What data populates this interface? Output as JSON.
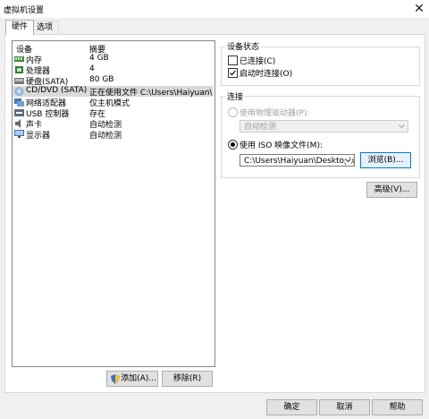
{
  "window": {
    "title": "虚拟机设置",
    "close_glyph": "✕"
  },
  "tabs": [
    {
      "label": "硬件"
    },
    {
      "label": "选项"
    }
  ],
  "device_list": {
    "headers": {
      "device": "设备",
      "summary": "摘要"
    },
    "rows": [
      {
        "name": "内存",
        "summary": "4 GB",
        "icon": "memory-icon"
      },
      {
        "name": "处理器",
        "summary": "4",
        "icon": "processor-icon"
      },
      {
        "name": "硬盘(SATA)",
        "summary": "80 GB",
        "icon": "hard-disk-icon"
      },
      {
        "name": "CD/DVD (SATA)",
        "summary": "正在使用文件 C:\\Users\\Haiyuan\\...",
        "icon": "cd-dvd-icon"
      },
      {
        "name": "网络适配器",
        "summary": "仅主机模式",
        "icon": "network-adapter-icon"
      },
      {
        "name": "USB 控制器",
        "summary": "存在",
        "icon": "usb-controller-icon"
      },
      {
        "name": "声卡",
        "summary": "自动检测",
        "icon": "sound-card-icon"
      },
      {
        "name": "显示器",
        "summary": "自动检测",
        "icon": "display-icon"
      }
    ],
    "selected_index": 3
  },
  "device_buttons": {
    "add": "添加(A)...",
    "remove": "移除(R)"
  },
  "device_status": {
    "legend": "设备状态",
    "connected_label": "已连接(C)",
    "connected_checked": false,
    "connect_at_poweron_label": "启动时连接(O)",
    "connect_at_poweron_checked": true
  },
  "connection": {
    "legend": "连接",
    "physical_drive_label": "使用物理驱动器(P):",
    "physical_drive_value": "自动检测",
    "iso_label": "使用 ISO 映像文件(M):",
    "iso_path": "C:\\Users\\Haiyuan\\Desktop\\un",
    "browse_label": "浏览(B)...",
    "selected": "iso"
  },
  "advanced_button": "高级(V)...",
  "footer": {
    "ok": "确定",
    "cancel": "取消",
    "help": "帮助"
  }
}
